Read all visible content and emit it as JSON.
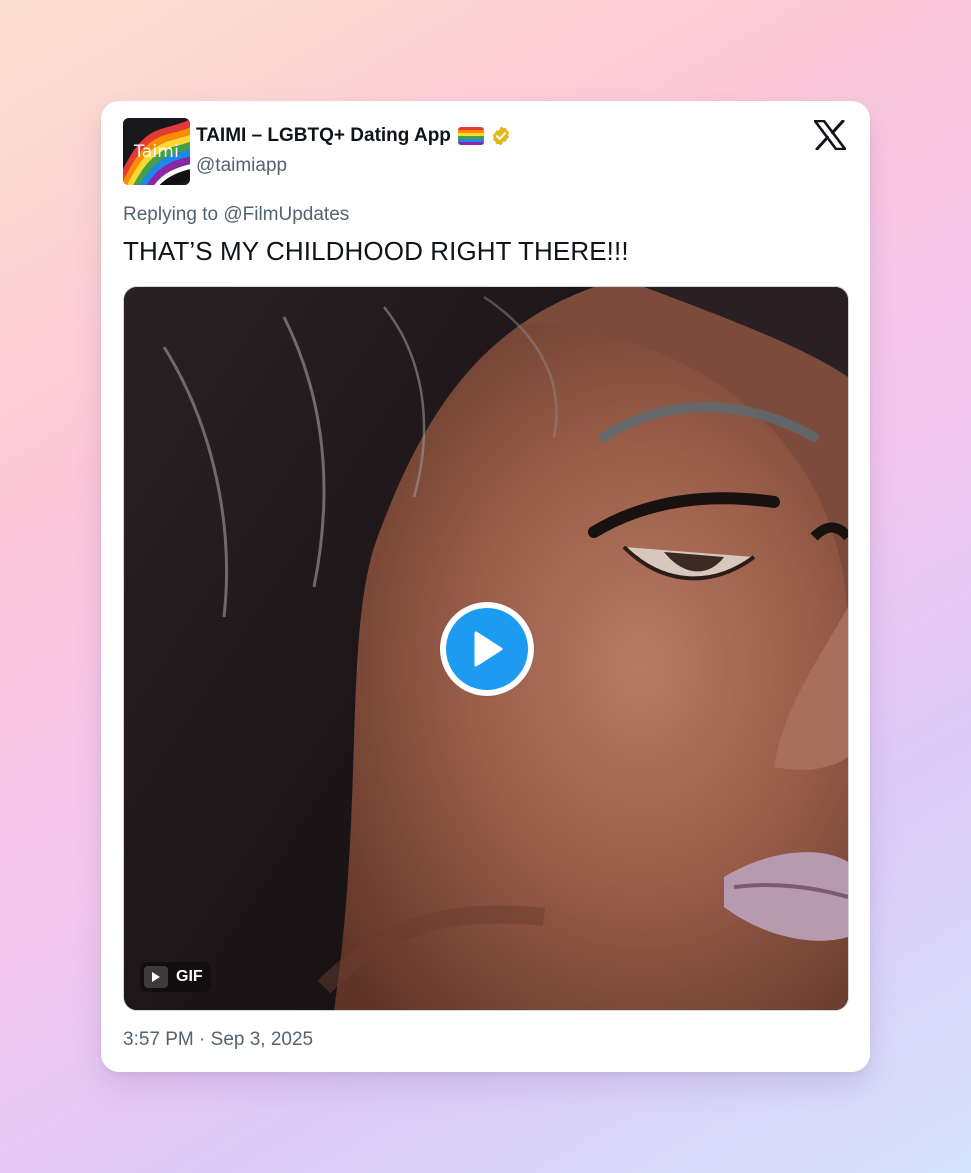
{
  "account": {
    "display_name": "TAIMI – LGBTQ+ Dating App",
    "handle": "@taimiapp",
    "avatar_text": "Taimi",
    "flag_icon": "rainbow-flag-icon",
    "verified_icon": "verified-badge-icon",
    "verified_color": "#e2b719"
  },
  "platform": {
    "logo_icon": "x-logo-icon"
  },
  "tweet": {
    "replying_prefix": "Replying to",
    "replying_to": "@FilmUpdates",
    "text": "THAT’S MY CHILDHOOD RIGHT THERE!!!",
    "timestamp": "3:57 PM · Sep 3, 2025"
  },
  "media": {
    "type_badge": "GIF",
    "play_icon": "play-icon",
    "accent_color": "#1d9bf0"
  }
}
